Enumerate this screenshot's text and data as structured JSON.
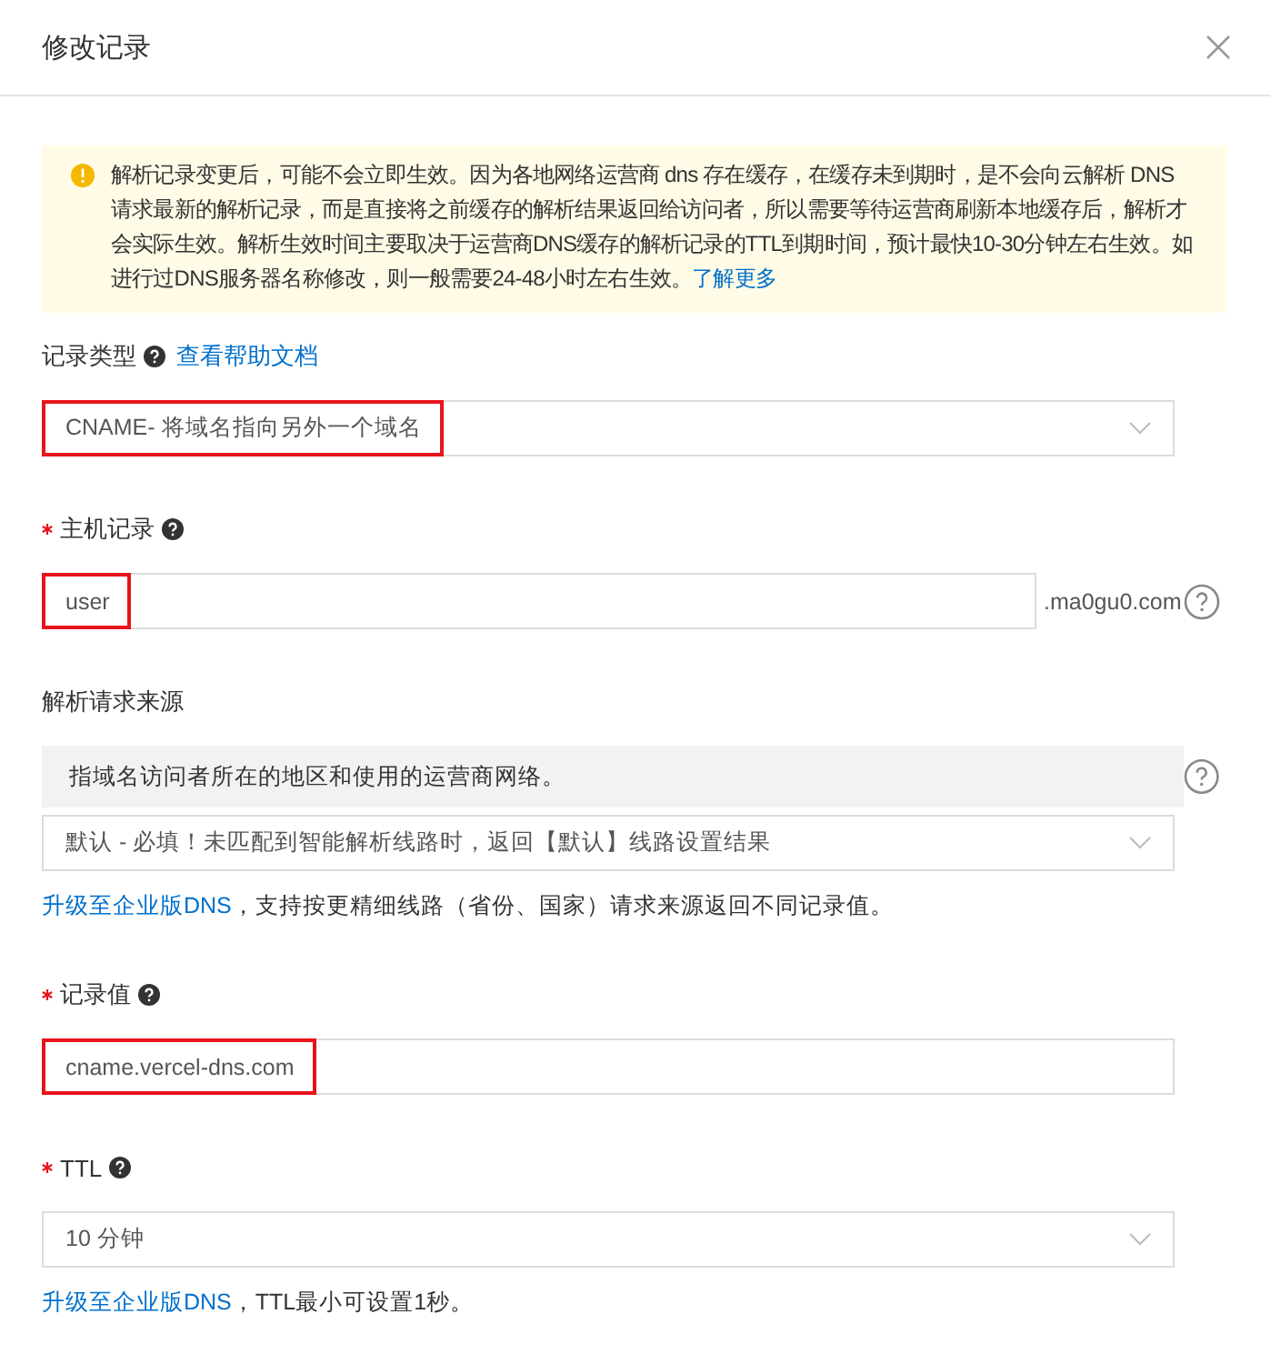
{
  "dialog": {
    "title": "修改记录"
  },
  "notice": {
    "text": "解析记录变更后，可能不会立即生效。因为各地网络运营商 dns 存在缓存，在缓存未到期时，是不会向云解析 DNS 请求最新的解析记录，而是直接将之前缓存的解析结果返回给访问者，所以需要等待运营商刷新本地缓存后，解析才会实际生效。解析生效时间主要取决于运营商DNS缓存的解析记录的TTL到期时间，预计最快10-30分钟左右生效。如进行过DNS服务器名称修改，则一般需要24-48小时左右生效。",
    "link": "了解更多"
  },
  "fields": [
    {
      "kind": "select",
      "label": "记录类型",
      "required": false,
      "help_icon": true,
      "label_link": "查看帮助文档",
      "value": "CNAME- 将域名指向另外一个域名",
      "highlighted": true
    },
    {
      "kind": "input",
      "label": "主机记录",
      "required": true,
      "help_icon": true,
      "value": "user",
      "suffix": ".ma0gu0.com",
      "highlighted": true
    },
    {
      "kind": "select",
      "label": "解析请求来源",
      "required": false,
      "help_icon": false,
      "hint": "指域名访问者所在的地区和使用的运营商网络。",
      "value": "默认 - 必填！未匹配到智能解析线路时，返回【默认】线路设置结果",
      "highlighted": false,
      "note": {
        "link": "升级至企业版DNS",
        "text": "，支持按更精细线路（省份、国家）请求来源返回不同记录值。"
      }
    },
    {
      "kind": "input",
      "label": "记录值",
      "required": true,
      "help_icon": true,
      "value": "cname.vercel-dns.com",
      "highlighted": true
    },
    {
      "kind": "select",
      "label": "TTL",
      "required": true,
      "help_icon": true,
      "value": "10 分钟",
      "highlighted": false,
      "note": {
        "link": "升级至企业版DNS",
        "text": "，TTL最小可设置1秒。"
      }
    }
  ]
}
